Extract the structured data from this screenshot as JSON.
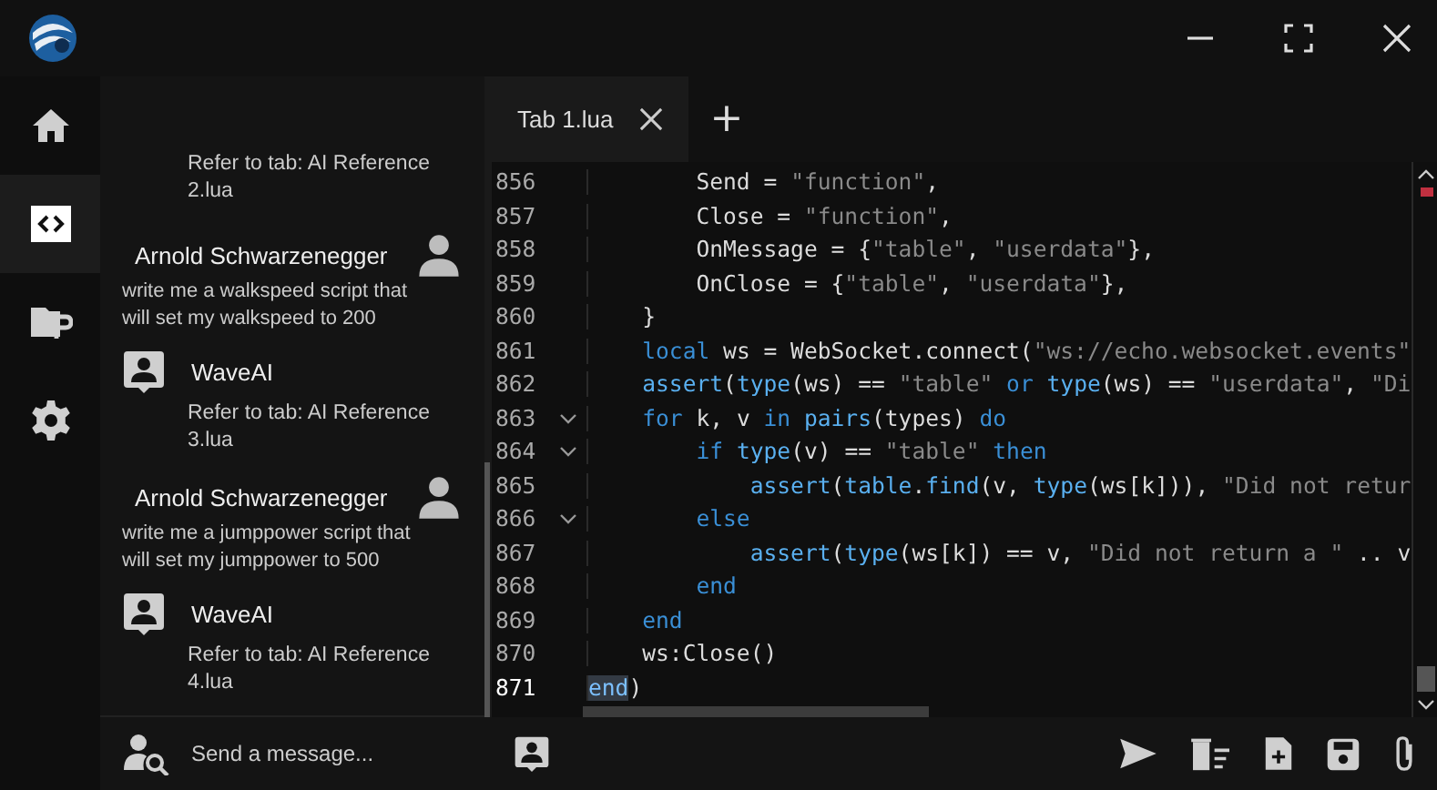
{
  "nav": [
    {
      "kind": "home",
      "selected": false
    },
    {
      "kind": "code",
      "selected": true
    },
    {
      "kind": "folder",
      "selected": false
    },
    {
      "kind": "settings",
      "selected": false
    }
  ],
  "chat": {
    "messages": [
      {
        "kind": "ai",
        "text": "Refer to tab: AI Reference 2.lua"
      },
      {
        "kind": "user",
        "name": "Arnold Schwarzenegger",
        "text": "write me a walkspeed script that will set my walkspeed to 200"
      },
      {
        "kind": "ai",
        "name": "WaveAI",
        "text": "Refer to tab: AI Reference 3.lua"
      },
      {
        "kind": "user",
        "name": "Arnold Schwarzenegger",
        "text": "write me a jumppower script that will set my jumppower to 500"
      },
      {
        "kind": "ai",
        "name": "WaveAI",
        "text": "Refer to tab: AI Reference 4.lua"
      }
    ],
    "input": {
      "placeholder": "Send a message..."
    }
  },
  "tabs": [
    {
      "label": "Tab 1.lua",
      "selected": true
    }
  ],
  "add_tab": "+",
  "code": [
    {
      "number": "856",
      "fold": false,
      "current": false,
      "tokens": [
        {
          "t": "        Send = ",
          "kind": "plain"
        },
        {
          "t": "\"function\"",
          "kind": "string"
        },
        {
          "t": ",",
          "kind": "plain"
        }
      ]
    },
    {
      "number": "857",
      "fold": false,
      "current": false,
      "tokens": [
        {
          "t": "        Close = ",
          "kind": "plain"
        },
        {
          "t": "\"function\"",
          "kind": "string"
        },
        {
          "t": ",",
          "kind": "plain"
        }
      ]
    },
    {
      "number": "858",
      "fold": false,
      "current": false,
      "tokens": [
        {
          "t": "        OnMessage = {",
          "kind": "plain"
        },
        {
          "t": "\"table\"",
          "kind": "string"
        },
        {
          "t": ", ",
          "kind": "plain"
        },
        {
          "t": "\"userdata\"",
          "kind": "string"
        },
        {
          "t": "},",
          "kind": "plain"
        }
      ]
    },
    {
      "number": "859",
      "fold": false,
      "current": false,
      "tokens": [
        {
          "t": "        OnClose = {",
          "kind": "plain"
        },
        {
          "t": "\"table\"",
          "kind": "string"
        },
        {
          "t": ", ",
          "kind": "plain"
        },
        {
          "t": "\"userdata\"",
          "kind": "string"
        },
        {
          "t": "},",
          "kind": "plain"
        }
      ]
    },
    {
      "number": "860",
      "fold": false,
      "current": false,
      "tokens": [
        {
          "t": "    }",
          "kind": "plain"
        }
      ]
    },
    {
      "number": "861",
      "fold": false,
      "current": false,
      "tokens": [
        {
          "t": "    local",
          "kind": "keyword"
        },
        {
          "t": " ws = WebSocket.connect(",
          "kind": "plain"
        },
        {
          "t": "\"ws://echo.websocket.events\"",
          "kind": "string"
        }
      ]
    },
    {
      "number": "862",
      "fold": false,
      "current": false,
      "tokens": [
        {
          "t": "    assert",
          "kind": "function"
        },
        {
          "t": "(",
          "kind": "plain"
        },
        {
          "t": "type",
          "kind": "function"
        },
        {
          "t": "(ws) == ",
          "kind": "plain"
        },
        {
          "t": "\"table\"",
          "kind": "string"
        },
        {
          "t": " or",
          "kind": "keyword"
        },
        {
          "t": " type",
          "kind": "function"
        },
        {
          "t": "(ws) == ",
          "kind": "plain"
        },
        {
          "t": "\"userdata\"",
          "kind": "string"
        },
        {
          "t": ", ",
          "kind": "plain"
        },
        {
          "t": "\"Di",
          "kind": "string"
        }
      ]
    },
    {
      "number": "863",
      "fold": true,
      "current": false,
      "tokens": [
        {
          "t": "    for",
          "kind": "keyword"
        },
        {
          "t": " k, v ",
          "kind": "plain"
        },
        {
          "t": "in",
          "kind": "keyword"
        },
        {
          "t": " pairs",
          "kind": "function"
        },
        {
          "t": "(types) ",
          "kind": "plain"
        },
        {
          "t": "do",
          "kind": "keyword"
        }
      ]
    },
    {
      "number": "864",
      "fold": true,
      "current": false,
      "tokens": [
        {
          "t": "        if",
          "kind": "keyword"
        },
        {
          "t": " type",
          "kind": "function"
        },
        {
          "t": "(v) == ",
          "kind": "plain"
        },
        {
          "t": "\"table\"",
          "kind": "string"
        },
        {
          "t": " then",
          "kind": "keyword"
        }
      ]
    },
    {
      "number": "865",
      "fold": false,
      "current": false,
      "tokens": [
        {
          "t": "            assert",
          "kind": "function"
        },
        {
          "t": "(",
          "kind": "plain"
        },
        {
          "t": "table",
          "kind": "function"
        },
        {
          "t": ".",
          "kind": "plain"
        },
        {
          "t": "find",
          "kind": "function"
        },
        {
          "t": "(v, ",
          "kind": "plain"
        },
        {
          "t": "type",
          "kind": "function"
        },
        {
          "t": "(ws[k])), ",
          "kind": "plain"
        },
        {
          "t": "\"Did not retur",
          "kind": "string"
        }
      ]
    },
    {
      "number": "866",
      "fold": true,
      "current": false,
      "tokens": [
        {
          "t": "        else",
          "kind": "keyword"
        }
      ]
    },
    {
      "number": "867",
      "fold": false,
      "current": false,
      "tokens": [
        {
          "t": "            assert",
          "kind": "function"
        },
        {
          "t": "(",
          "kind": "plain"
        },
        {
          "t": "type",
          "kind": "function"
        },
        {
          "t": "(ws[k]) == v, ",
          "kind": "plain"
        },
        {
          "t": "\"Did not return a \"",
          "kind": "string"
        },
        {
          "t": " .. v",
          "kind": "plain"
        }
      ]
    },
    {
      "number": "868",
      "fold": false,
      "current": false,
      "tokens": [
        {
          "t": "        end",
          "kind": "keyword"
        }
      ]
    },
    {
      "number": "869",
      "fold": false,
      "current": false,
      "tokens": [
        {
          "t": "    end",
          "kind": "keyword"
        }
      ]
    },
    {
      "number": "870",
      "fold": false,
      "current": false,
      "tokens": [
        {
          "t": "    ws:Close()",
          "kind": "plain"
        }
      ]
    },
    {
      "number": "871",
      "fold": false,
      "current": true,
      "tokens": [
        {
          "t": "end",
          "kind": "selection"
        },
        {
          "t": ")",
          "kind": "plain"
        }
      ]
    }
  ],
  "toolbar": [
    {
      "kind": "send"
    },
    {
      "kind": "clear"
    },
    {
      "kind": "new-file"
    },
    {
      "kind": "save"
    },
    {
      "kind": "attach"
    }
  ]
}
